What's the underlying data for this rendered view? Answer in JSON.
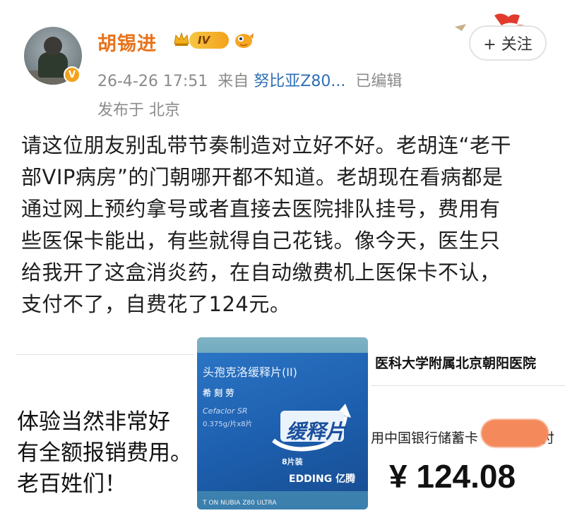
{
  "post": {
    "username": "胡锡进",
    "badge": "IV",
    "time": "26-4-26 17:51",
    "from_label": "来自",
    "device": "努比亚Z80...",
    "edited": "已编辑",
    "location": "发布于 北京",
    "follow_label": "+ 关注",
    "text_lines": [
      "请这位朋友别乱带节奏制造对立好不好。老胡连“老干",
      "部VIP病房”的门朝哪开都不知道。老胡现在看病都是",
      "通过网上预约拿号或者直接去医院排队挂号，费用有",
      "些医保卡能出，有些就得自己花钱。像今天，医生只",
      "给我开了这盒消炎药，在自动缴费机上医保卡不认，",
      "支付不了，自费花了124元。"
    ]
  },
  "images": {
    "left": {
      "lines": [
        "体验当然非常好",
        "有全额报销费用。",
        "老百姓们！"
      ]
    },
    "middle": {
      "title": "头孢克洛缓释片(II)",
      "brand": "希 刻 劳",
      "en": "Cefaclor SR",
      "dose": "0.375g/片x8片",
      "release": "缓释片",
      "count": "8片装",
      "maker": "EDDING 亿腾",
      "shot_on": "T ON NUBIA Z80 ULTRA"
    },
    "right": {
      "hospital": "医科大学附属北京朝阳医院",
      "payment": "用中国银行储蓄卡",
      "payment_suffix": "支付",
      "amount": "¥ 124.08"
    }
  },
  "colors": {
    "username": "#e8731b",
    "device_link": "#2f6fb5",
    "meta": "#8b8b8b",
    "verified": "#f3a21c"
  }
}
